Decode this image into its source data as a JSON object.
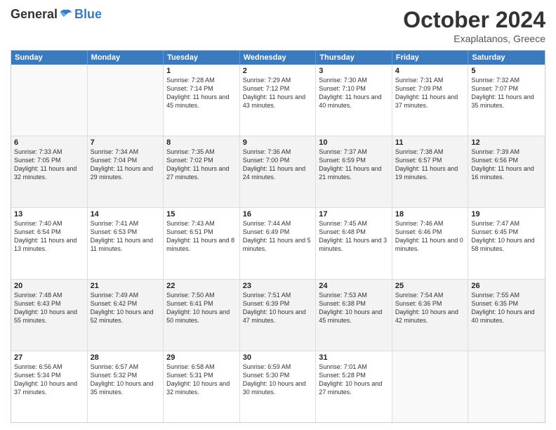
{
  "header": {
    "logo_general": "General",
    "logo_blue": "Blue",
    "month": "October 2024",
    "location": "Exaplatanos, Greece"
  },
  "calendar": {
    "days": [
      "Sunday",
      "Monday",
      "Tuesday",
      "Wednesday",
      "Thursday",
      "Friday",
      "Saturday"
    ],
    "rows": [
      [
        {
          "day": "",
          "text": ""
        },
        {
          "day": "",
          "text": ""
        },
        {
          "day": "1",
          "text": "Sunrise: 7:28 AM\nSunset: 7:14 PM\nDaylight: 11 hours\nand 45 minutes."
        },
        {
          "day": "2",
          "text": "Sunrise: 7:29 AM\nSunset: 7:12 PM\nDaylight: 11 hours\nand 43 minutes."
        },
        {
          "day": "3",
          "text": "Sunrise: 7:30 AM\nSunset: 7:10 PM\nDaylight: 11 hours\nand 40 minutes."
        },
        {
          "day": "4",
          "text": "Sunrise: 7:31 AM\nSunset: 7:09 PM\nDaylight: 11 hours\nand 37 minutes."
        },
        {
          "day": "5",
          "text": "Sunrise: 7:32 AM\nSunset: 7:07 PM\nDaylight: 11 hours\nand 35 minutes."
        }
      ],
      [
        {
          "day": "6",
          "text": "Sunrise: 7:33 AM\nSunset: 7:05 PM\nDaylight: 11 hours\nand 32 minutes."
        },
        {
          "day": "7",
          "text": "Sunrise: 7:34 AM\nSunset: 7:04 PM\nDaylight: 11 hours\nand 29 minutes."
        },
        {
          "day": "8",
          "text": "Sunrise: 7:35 AM\nSunset: 7:02 PM\nDaylight: 11 hours\nand 27 minutes."
        },
        {
          "day": "9",
          "text": "Sunrise: 7:36 AM\nSunset: 7:00 PM\nDaylight: 11 hours\nand 24 minutes."
        },
        {
          "day": "10",
          "text": "Sunrise: 7:37 AM\nSunset: 6:59 PM\nDaylight: 11 hours\nand 21 minutes."
        },
        {
          "day": "11",
          "text": "Sunrise: 7:38 AM\nSunset: 6:57 PM\nDaylight: 11 hours\nand 19 minutes."
        },
        {
          "day": "12",
          "text": "Sunrise: 7:39 AM\nSunset: 6:56 PM\nDaylight: 11 hours\nand 16 minutes."
        }
      ],
      [
        {
          "day": "13",
          "text": "Sunrise: 7:40 AM\nSunset: 6:54 PM\nDaylight: 11 hours\nand 13 minutes."
        },
        {
          "day": "14",
          "text": "Sunrise: 7:41 AM\nSunset: 6:53 PM\nDaylight: 11 hours\nand 11 minutes."
        },
        {
          "day": "15",
          "text": "Sunrise: 7:43 AM\nSunset: 6:51 PM\nDaylight: 11 hours\nand 8 minutes."
        },
        {
          "day": "16",
          "text": "Sunrise: 7:44 AM\nSunset: 6:49 PM\nDaylight: 11 hours\nand 5 minutes."
        },
        {
          "day": "17",
          "text": "Sunrise: 7:45 AM\nSunset: 6:48 PM\nDaylight: 11 hours\nand 3 minutes."
        },
        {
          "day": "18",
          "text": "Sunrise: 7:46 AM\nSunset: 6:46 PM\nDaylight: 11 hours\nand 0 minutes."
        },
        {
          "day": "19",
          "text": "Sunrise: 7:47 AM\nSunset: 6:45 PM\nDaylight: 10 hours\nand 58 minutes."
        }
      ],
      [
        {
          "day": "20",
          "text": "Sunrise: 7:48 AM\nSunset: 6:43 PM\nDaylight: 10 hours\nand 55 minutes."
        },
        {
          "day": "21",
          "text": "Sunrise: 7:49 AM\nSunset: 6:42 PM\nDaylight: 10 hours\nand 52 minutes."
        },
        {
          "day": "22",
          "text": "Sunrise: 7:50 AM\nSunset: 6:41 PM\nDaylight: 10 hours\nand 50 minutes."
        },
        {
          "day": "23",
          "text": "Sunrise: 7:51 AM\nSunset: 6:39 PM\nDaylight: 10 hours\nand 47 minutes."
        },
        {
          "day": "24",
          "text": "Sunrise: 7:53 AM\nSunset: 6:38 PM\nDaylight: 10 hours\nand 45 minutes."
        },
        {
          "day": "25",
          "text": "Sunrise: 7:54 AM\nSunset: 6:36 PM\nDaylight: 10 hours\nand 42 minutes."
        },
        {
          "day": "26",
          "text": "Sunrise: 7:55 AM\nSunset: 6:35 PM\nDaylight: 10 hours\nand 40 minutes."
        }
      ],
      [
        {
          "day": "27",
          "text": "Sunrise: 6:56 AM\nSunset: 5:34 PM\nDaylight: 10 hours\nand 37 minutes."
        },
        {
          "day": "28",
          "text": "Sunrise: 6:57 AM\nSunset: 5:32 PM\nDaylight: 10 hours\nand 35 minutes."
        },
        {
          "day": "29",
          "text": "Sunrise: 6:58 AM\nSunset: 5:31 PM\nDaylight: 10 hours\nand 32 minutes."
        },
        {
          "day": "30",
          "text": "Sunrise: 6:59 AM\nSunset: 5:30 PM\nDaylight: 10 hours\nand 30 minutes."
        },
        {
          "day": "31",
          "text": "Sunrise: 7:01 AM\nSunset: 5:28 PM\nDaylight: 10 hours\nand 27 minutes."
        },
        {
          "day": "",
          "text": ""
        },
        {
          "day": "",
          "text": ""
        }
      ]
    ]
  }
}
